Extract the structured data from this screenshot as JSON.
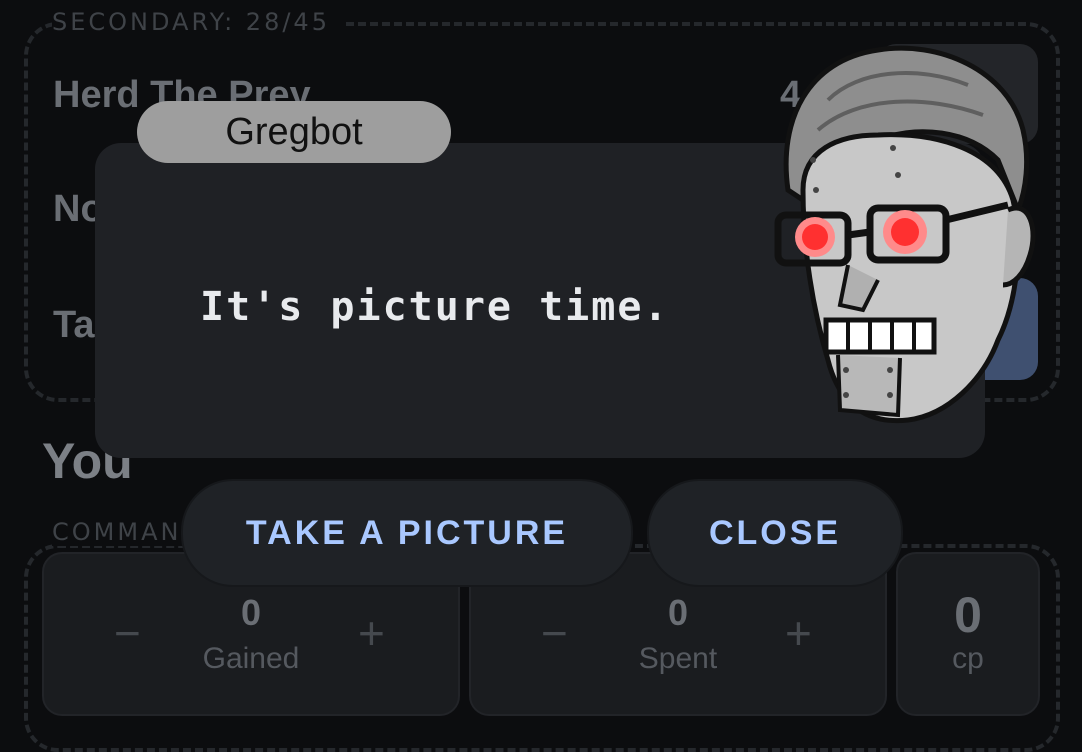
{
  "background": {
    "secondary_label": "SECONDARY: 28/45",
    "rows": [
      {
        "label": "Herd The Prey",
        "value": "4"
      },
      {
        "label": "No",
        "value": ""
      },
      {
        "label": "Ta",
        "value": ""
      }
    ],
    "you_heading": "You",
    "command_label": "COMMAN",
    "panels": [
      {
        "value": "0",
        "caption": "Gained",
        "minus": "−",
        "plus": "+"
      },
      {
        "value": "0",
        "caption": "Spent",
        "minus": "−",
        "plus": "+"
      },
      {
        "value": "0",
        "caption": "cp"
      }
    ]
  },
  "dialog": {
    "speaker": "Gregbot",
    "message": "It's picture time.",
    "take_picture_label": "TAKE A PICTURE",
    "close_label": "CLOSE",
    "avatar_icon": "robot-face-icon"
  },
  "colors": {
    "accent": "#a9c8ff",
    "dialog_bg": "#1f2125",
    "speaker_bg": "#9e9e9e",
    "robot_eye": "#ff3030"
  }
}
